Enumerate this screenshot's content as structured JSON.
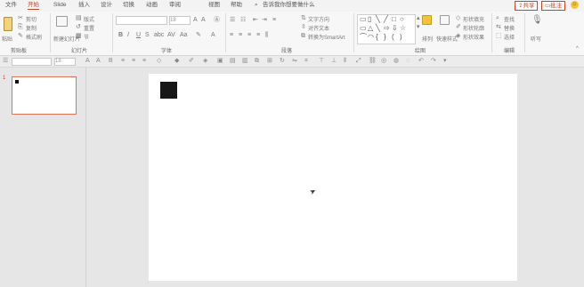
{
  "menu": {
    "tabs": [
      {
        "label": "文件",
        "active": false
      },
      {
        "label": "开始",
        "active": true
      },
      {
        "label": "Slide",
        "active": false
      },
      {
        "label": "插入",
        "active": false
      },
      {
        "label": "设计",
        "active": false
      },
      {
        "label": "切换",
        "active": false
      },
      {
        "label": "动画",
        "active": false
      },
      {
        "label": "审阅",
        "active": false
      },
      {
        "label": "视图",
        "active": false
      },
      {
        "label": "帮助",
        "active": false
      }
    ],
    "search_placeholder": "告诉我你想要做什么",
    "share_label": "共享",
    "comment_label": "批注"
  },
  "ribbon": {
    "groups": {
      "clipboard": "剪贴板",
      "slides": "幻灯片",
      "font": "字体",
      "paragraph": "段落",
      "drawing": "绘图",
      "editing": "编辑"
    },
    "clipboard": {
      "paste": "粘贴",
      "cut": "剪切",
      "copy": "复制",
      "format_painter": "格式刷"
    },
    "slides": {
      "new_slide": "新建幻灯片",
      "layout": "版式",
      "reset": "重置",
      "section": "节"
    },
    "font": {
      "font_name": "",
      "font_size": "18"
    },
    "paragraph": {
      "text_direction": "文字方向",
      "align_text": "对齐文本",
      "smartart": "转换为SmartArt"
    },
    "drawing": {
      "arrange": "排列",
      "quick_styles": "快速样式",
      "shape_fill": "形状填充",
      "shape_outline": "形状轮廓",
      "shape_effects": "形状效果"
    },
    "editing": {
      "find": "查找",
      "replace": "替换",
      "select": "选择"
    },
    "voice": {
      "dictate": "听写"
    }
  },
  "format_bar": {
    "font_size": "18"
  },
  "thumbnails": {
    "slide_number": "1"
  }
}
